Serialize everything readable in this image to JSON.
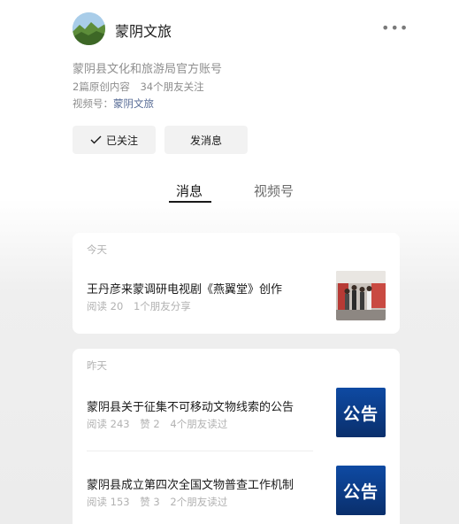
{
  "account": {
    "name": "蒙阴文旅",
    "description": "蒙阴县文化和旅游局官方账号",
    "stats": [
      "2篇原创内容",
      "34个朋友关注"
    ],
    "channel_label": "视频号：",
    "channel_value": "蒙阴文旅"
  },
  "actions": {
    "follow_label": "已关注",
    "message_label": "发消息"
  },
  "tabs": [
    {
      "label": "消息",
      "active": true
    },
    {
      "label": "视频号",
      "active": false
    }
  ],
  "feed": {
    "today": {
      "label": "今天",
      "articles": [
        {
          "title": "王丹彦来蒙调研电视剧《燕翼堂》创作",
          "meta": [
            "阅读 20",
            "1个朋友分享"
          ],
          "thumbnail": "photo"
        }
      ]
    },
    "yesterday": {
      "label": "昨天",
      "articles": [
        {
          "title": "蒙阴县关于征集不可移动文物线索的公告",
          "meta": [
            "阅读 243",
            "赞 2",
            "4个朋友读过"
          ],
          "thumbnail_text": "公告"
        },
        {
          "title": "蒙阴县成立第四次全国文物普查工作机制",
          "meta": [
            "阅读 153",
            "赞 3",
            "2个朋友读过"
          ],
          "thumbnail_text": "公告"
        }
      ]
    }
  },
  "icons": [
    "more-icon",
    "check-icon"
  ],
  "colors": {
    "link": "#576b95",
    "notice_blue": "#0e4aa3"
  }
}
